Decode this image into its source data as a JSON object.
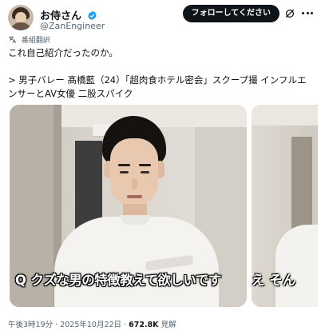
{
  "author": {
    "display_name": "お侍さん",
    "handle": "@ZanEngineer"
  },
  "actions": {
    "follow_label": "フォローしてください"
  },
  "translate_label": "番組翻訳",
  "tweet": {
    "line1": "これ自己紹介だったのか。",
    "line2": "> 男子バレー 髙橋藍（24）「超肉食ホテル密会」スクープ撮 インフルエ",
    "line3": "ンサーとAV女優 二股スパイク"
  },
  "media": {
    "subtitle_q": "Q",
    "subtitle_text": "クズな男の特徴教えて欲しいです",
    "subtitle2_text": "え そん"
  },
  "meta": {
    "time": "午後3時19分",
    "separator": " · ",
    "date": "2025年10月22日",
    "views_count": "672.8K",
    "views_label": " 見解"
  },
  "colors": {
    "text": "#0f1419",
    "secondary": "#536471",
    "verified": "#1d9bf0",
    "follow_bg": "#0f1419"
  }
}
